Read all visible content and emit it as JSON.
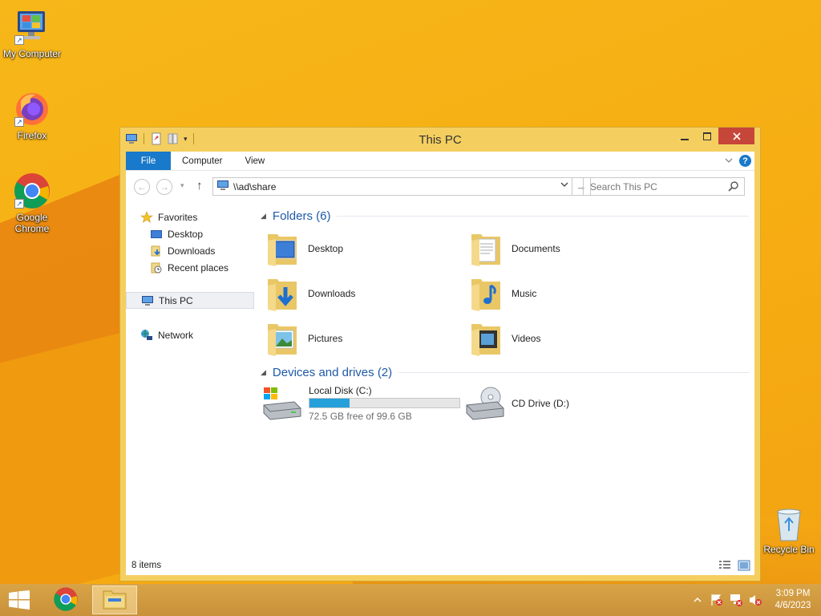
{
  "desktop": {
    "icons": [
      {
        "label": "My Computer"
      },
      {
        "label": "Firefox"
      },
      {
        "label": "Google Chrome"
      },
      {
        "label": "Recycle Bin"
      }
    ]
  },
  "window": {
    "title": "This PC",
    "ribbon": {
      "tabs": [
        "File",
        "Computer",
        "View"
      ]
    },
    "address": {
      "path": "\\\\ad\\share"
    },
    "search": {
      "placeholder": "Search This PC"
    },
    "nav_pane": {
      "favorites": "Favorites",
      "favorites_items": [
        "Desktop",
        "Downloads",
        "Recent places"
      ],
      "this_pc": "This PC",
      "network": "Network"
    },
    "folders_group": {
      "title": "Folders (6)",
      "items": [
        "Desktop",
        "Documents",
        "Downloads",
        "Music",
        "Pictures",
        "Videos"
      ]
    },
    "drives_group": {
      "title": "Devices and drives (2)",
      "local_disk": {
        "label": "Local Disk (C:)",
        "space_text": "72.5 GB free of 99.6 GB",
        "used_fraction": 0.27
      },
      "cd_drive": {
        "label": "CD Drive (D:)"
      }
    },
    "status": {
      "items_count": "8 items"
    }
  },
  "taskbar": {
    "clock_time": "3:09 PM",
    "clock_date": "4/6/2023"
  },
  "colors": {
    "accent": "#1979ca",
    "window_frame": "#f4cf60",
    "close_button": "#c7463a",
    "drive_bar": "#26a0da",
    "group_title": "#1e5aa8"
  }
}
